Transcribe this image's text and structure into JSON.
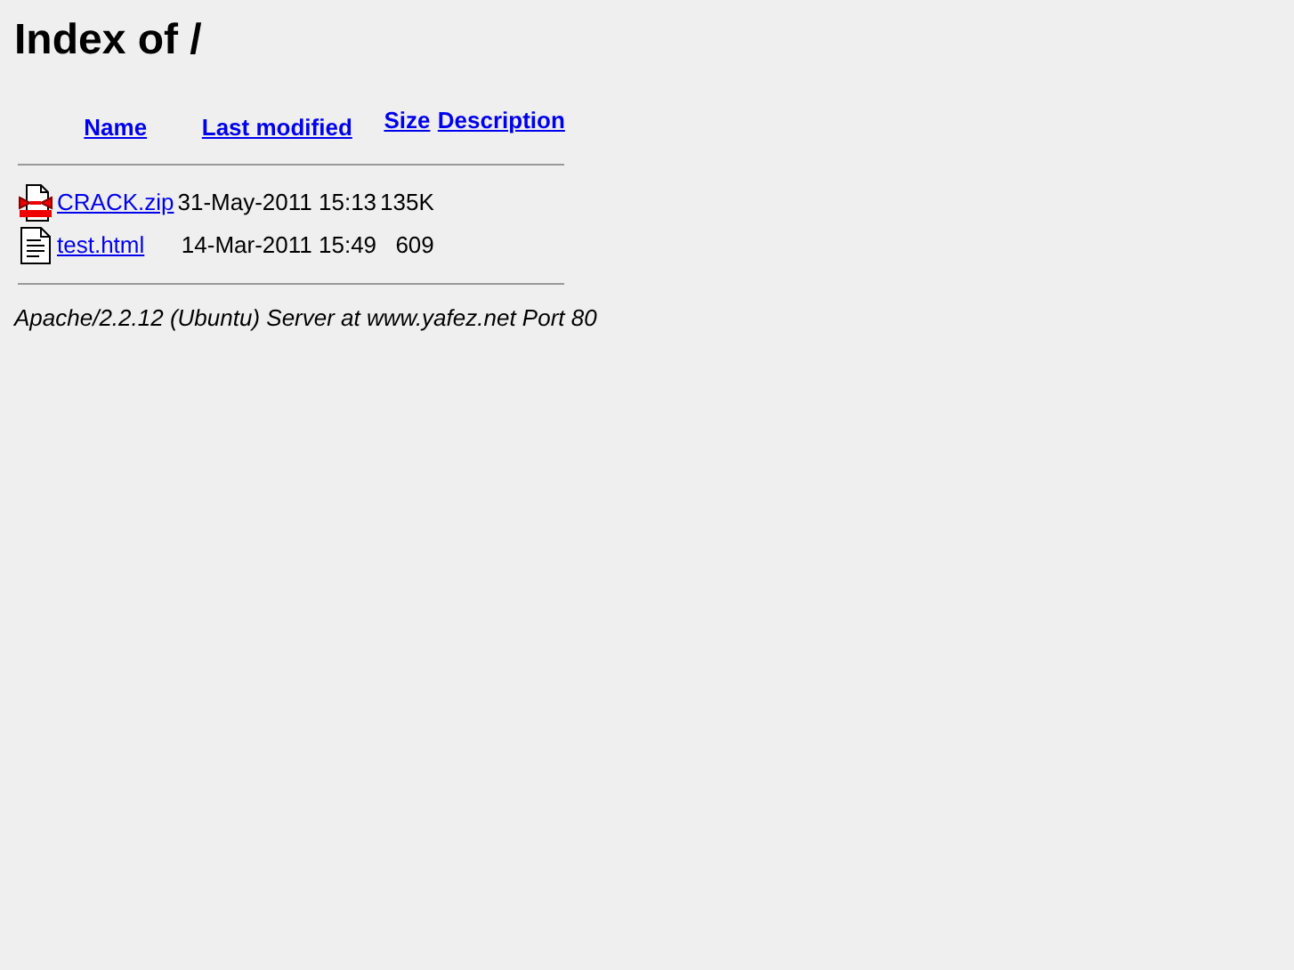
{
  "title": "Index of /",
  "columns": [
    "Name",
    "Last modified",
    "Size",
    "Description"
  ],
  "rows": [
    {
      "kind": "archive",
      "name": "CRACK.zip",
      "modified": "31-May-2011 15:13",
      "size": "135K"
    },
    {
      "kind": "text",
      "name": "test.html",
      "modified": "14-Mar-2011 15:49",
      "size": "609"
    }
  ],
  "address": "Apache/2.2.12 (Ubuntu) Server at www.yafez.net Port 80"
}
